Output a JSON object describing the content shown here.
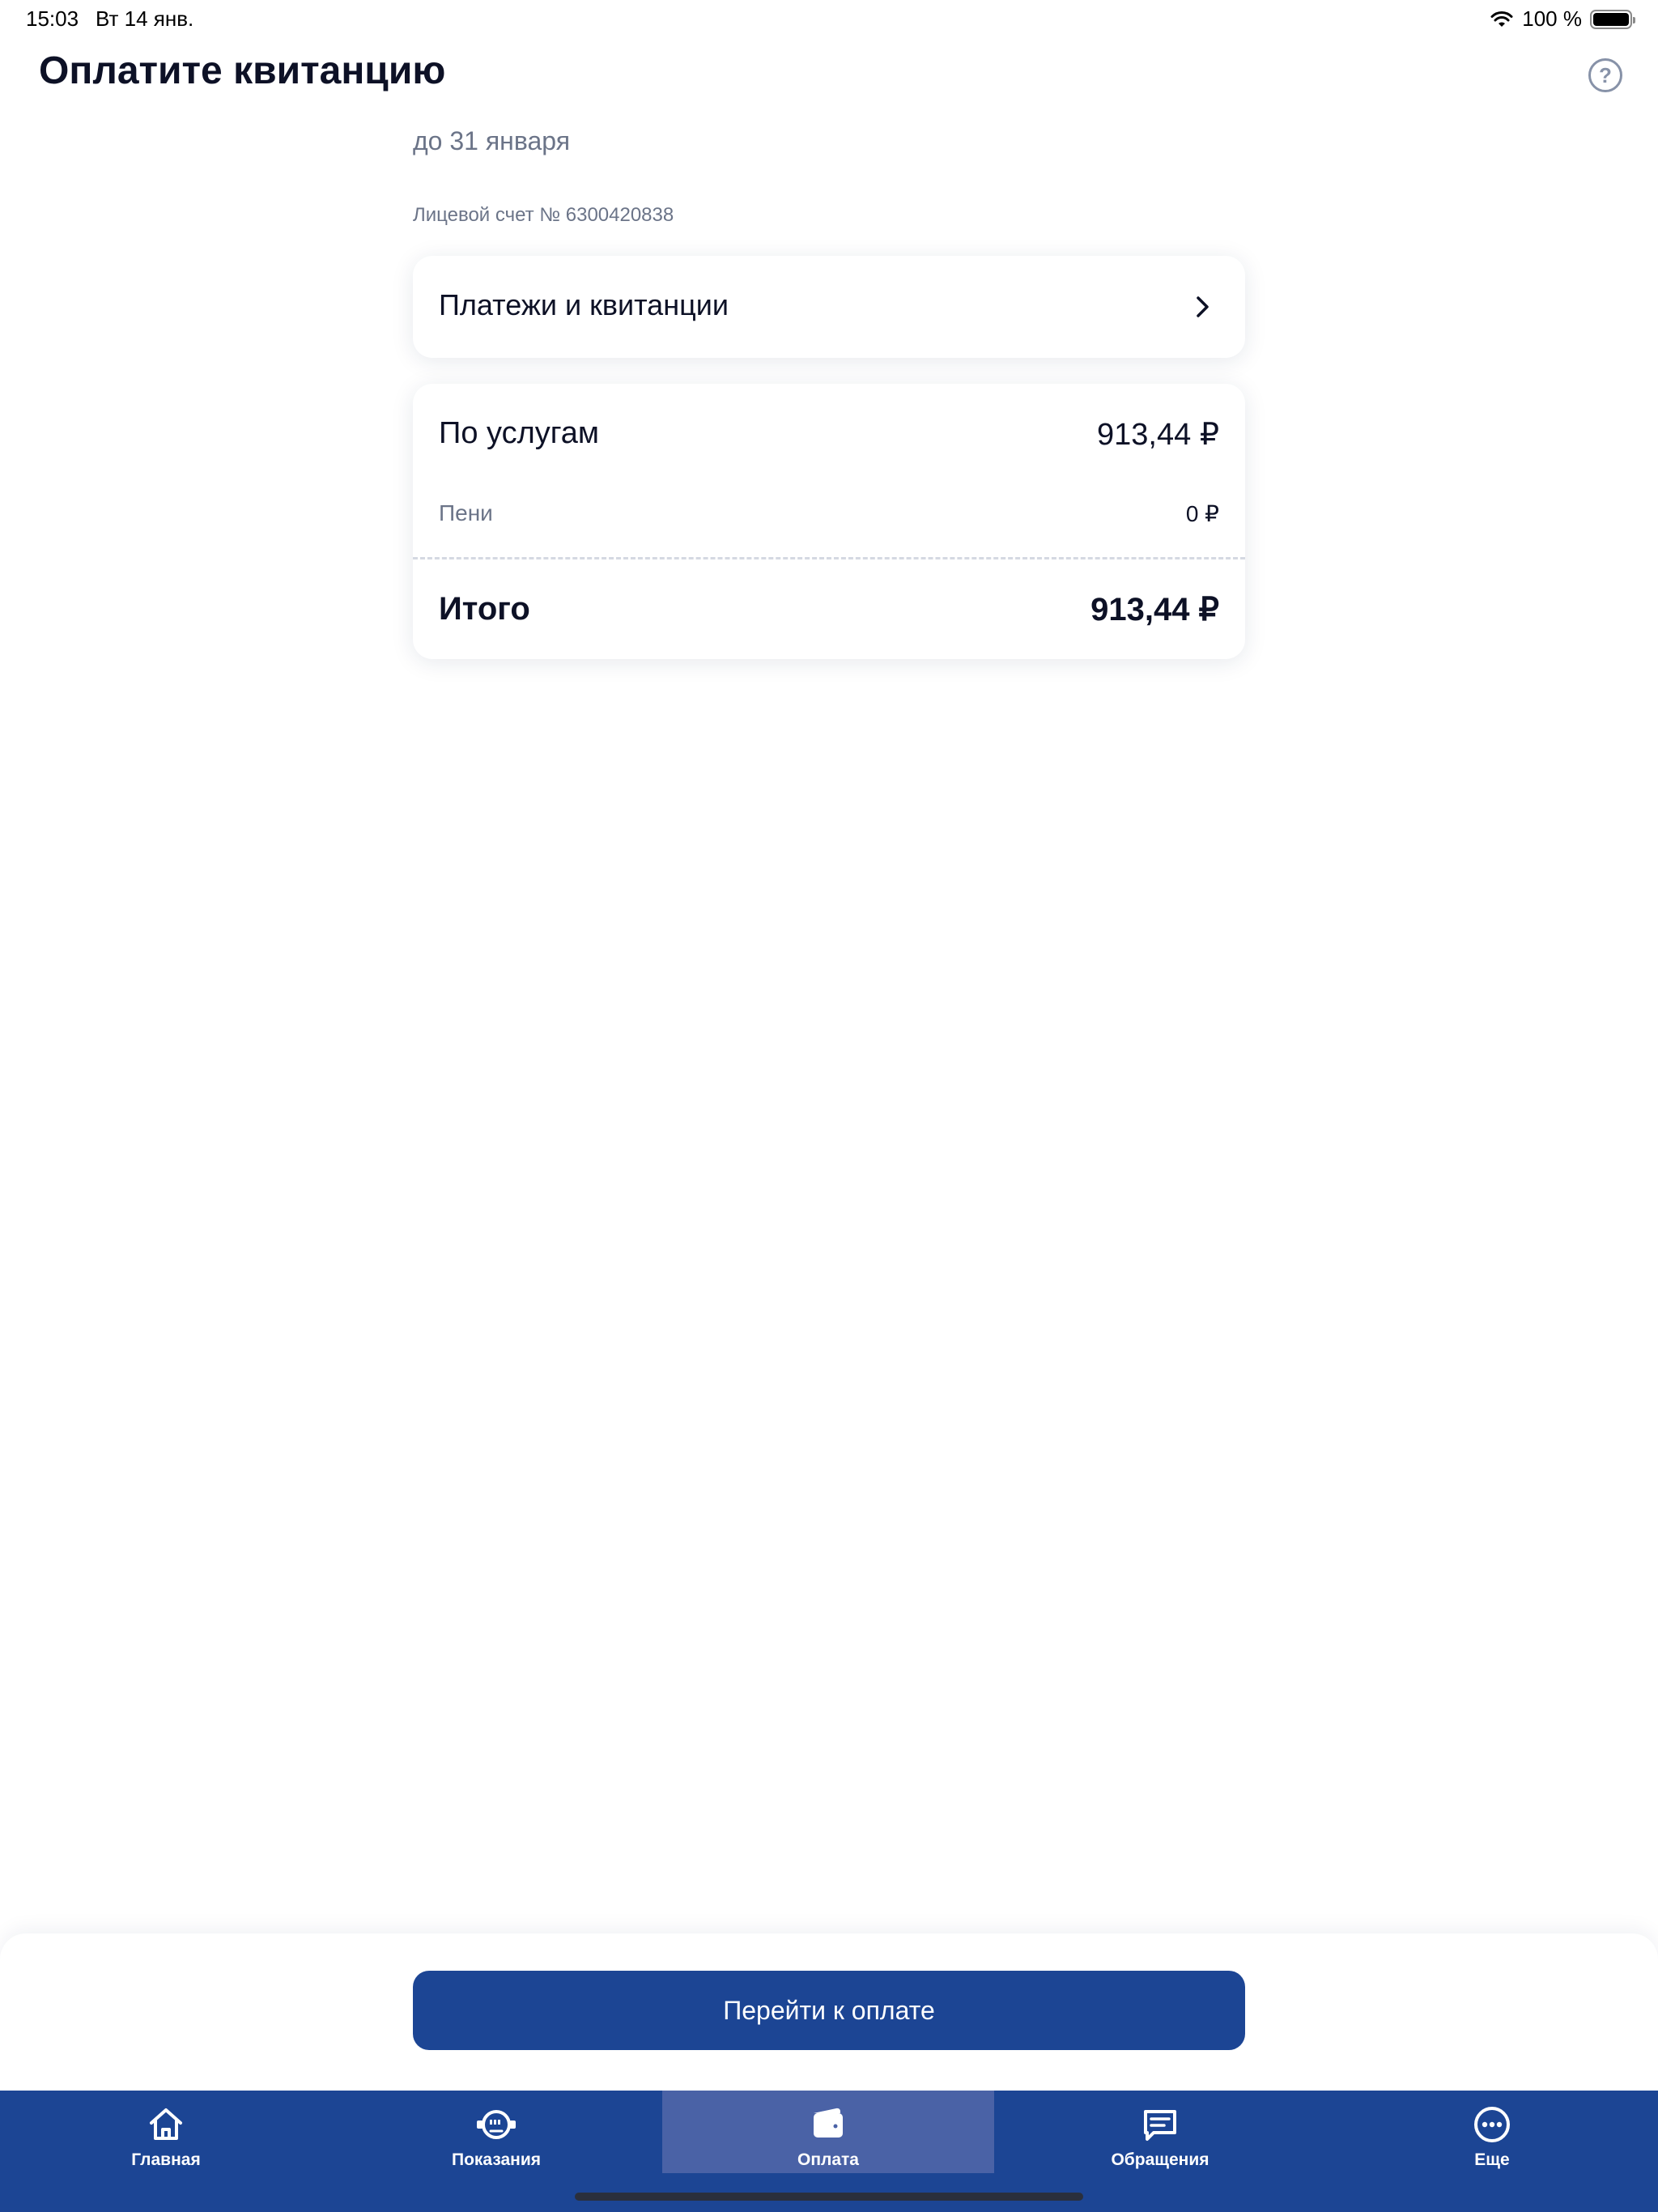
{
  "status_bar": {
    "time": "15:03",
    "date": "Вт 14 янв.",
    "battery": "100 %"
  },
  "header": {
    "title": "Оплатите квитанцию",
    "help_icon": "question-circle-icon"
  },
  "due_date": "до 31 января",
  "account": "Лицевой счет № 6300420838",
  "payments_link": {
    "label": "Платежи и квитанции",
    "icon": "chevron-right-icon"
  },
  "summary": {
    "services_label": "По услугам",
    "services_value": "913,44 ₽",
    "penalty_label": "Пени",
    "penalty_value": "0 ₽",
    "total_label": "Итого",
    "total_value": "913,44 ₽"
  },
  "pay_button": "Перейти к оплате",
  "tabs": [
    {
      "label": "Главная",
      "icon": "home-icon"
    },
    {
      "label": "Показания",
      "icon": "meter-icon"
    },
    {
      "label": "Оплата",
      "icon": "wallet-icon",
      "active": true
    },
    {
      "label": "Обращения",
      "icon": "message-icon"
    },
    {
      "label": "Еще",
      "icon": "more-icon"
    }
  ],
  "colors": {
    "brand": "#1c4594",
    "active_tab": "#4a62a6",
    "secondary_text": "#6b7488"
  }
}
